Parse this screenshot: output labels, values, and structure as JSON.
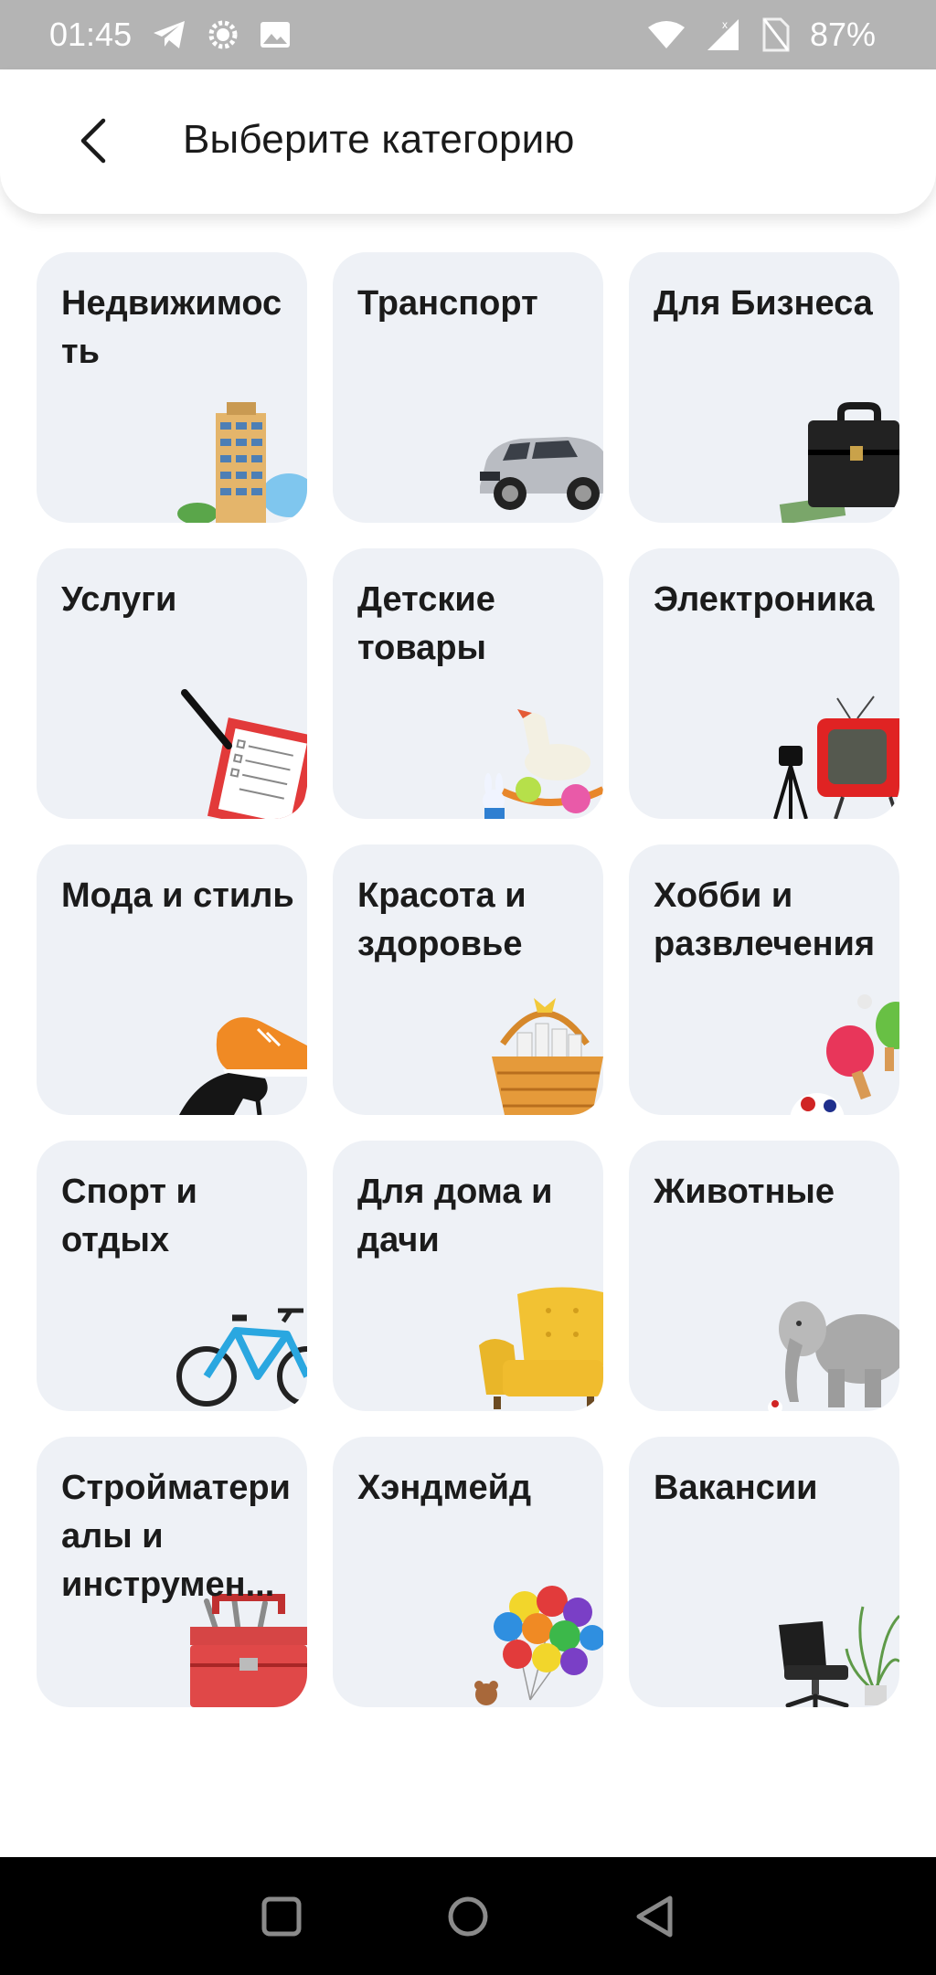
{
  "status_bar": {
    "time": "01:45",
    "battery": "87%",
    "icons": [
      "telegram-icon",
      "settings-gear-icon",
      "gallery-icon",
      "wifi-icon",
      "signal-icon",
      "no-sim-icon"
    ]
  },
  "header": {
    "back_icon": "chevron-left-icon",
    "title": "Выберите категорию"
  },
  "categories": [
    {
      "label": "Недвижимость",
      "icon": "apartment-building-icon"
    },
    {
      "label": "Транспорт",
      "icon": "car-icon"
    },
    {
      "label": "Для Бизнеса",
      "icon": "briefcase-icon"
    },
    {
      "label": "Услуги",
      "icon": "clipboard-checklist-icon"
    },
    {
      "label": "Детские товары",
      "icon": "rocking-horse-toy-icon"
    },
    {
      "label": "Электроника",
      "icon": "tv-camera-icon"
    },
    {
      "label": "Мода и стиль",
      "icon": "shoes-icon"
    },
    {
      "label": "Красота и здоровье",
      "icon": "cosmetics-basket-icon"
    },
    {
      "label": "Хобби и развлечения",
      "icon": "ping-pong-ball-icon"
    },
    {
      "label": "Спорт и отдых",
      "icon": "bicycle-icon"
    },
    {
      "label": "Для дома и дачи",
      "icon": "armchair-icon"
    },
    {
      "label": "Животные",
      "icon": "elephant-icon"
    },
    {
      "label": "Стройматериалы и инструмен...",
      "icon": "toolbox-icon"
    },
    {
      "label": "Хэндмейд",
      "icon": "balloons-icon"
    },
    {
      "label": "Вакансии",
      "icon": "office-chair-plant-icon"
    }
  ],
  "nav_bar": {
    "buttons": [
      "recents-square-icon",
      "home-circle-icon",
      "back-triangle-icon"
    ]
  }
}
